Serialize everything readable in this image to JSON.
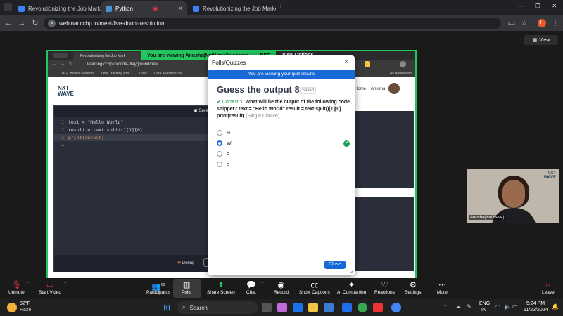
{
  "browser": {
    "tabs": [
      {
        "title": "Revolutionizing the Job Marke",
        "active": false
      },
      {
        "title": "Python",
        "active": true
      },
      {
        "title": "Revolutionizing the Job Marke",
        "active": false
      }
    ],
    "url": "webinar.ccbp.in/meet/live-doubt-resolution",
    "profile_initial": "H"
  },
  "meeting": {
    "view_label": "View",
    "share_banner": "You are viewing  Anusha(NxtWave)'s screen",
    "rec_label": "REC",
    "view_options": "View Options",
    "inner_tab": "Revolutionizing the Job Mark",
    "inner_url": "learning.ccbp.in/code-playground/new",
    "bookmarks": [
      "RGL Bonus Session",
      "Time Tracking Ass...",
      "Calls",
      "Data Analytics Se...",
      "All Bookmarks"
    ],
    "inner_nav": [
      "Home",
      "Anusha"
    ],
    "logo_top": "NXT",
    "logo_bottom": "WAVE",
    "save_label": "Save",
    "debug_label": "Debug",
    "code": [
      {
        "n": "1",
        "text": "text = \"Hello World\""
      },
      {
        "n": "2",
        "text": "result = text.split()[1][0]"
      },
      {
        "n": "3",
        "text": "print(result)"
      },
      {
        "n": "4",
        "text": ""
      }
    ]
  },
  "modal": {
    "header": "Polls/Quizzes",
    "close_icon": "×",
    "banner": "You are viewing your quiz results",
    "title": "Guess the output 8",
    "saved": "Saved",
    "status": "Correct",
    "question": "1. What will be the output of the following code snippet? text = \"Hello World\" result = text.split()[1][0] print(result)",
    "question_type": "(Single Choice)",
    "options": [
      {
        "label": "H",
        "selected": false,
        "correct": false
      },
      {
        "label": "W",
        "selected": true,
        "correct": true
      },
      {
        "label": "o",
        "selected": false,
        "correct": false
      },
      {
        "label": "e",
        "selected": false,
        "correct": false
      }
    ],
    "close_button": "Close"
  },
  "video": {
    "name": "Anusha(NxtWave)",
    "logo_top": "NXT",
    "logo_bottom": "WAVE"
  },
  "toolbar": {
    "unmute": "Unmute",
    "start_video": "Start Video",
    "participants": "Participants",
    "participants_count": "69",
    "polls": "Polls",
    "share_screen": "Share Screen",
    "chat": "Chat",
    "record": "Record",
    "captions": "Show Captions",
    "companion": "AI Companion",
    "reactions": "Reactions",
    "settings": "Settings",
    "more": "More",
    "leave": "Leave"
  },
  "taskbar": {
    "temp": "82°F",
    "weather": "Haze",
    "search": "Search",
    "lang_top": "ENG",
    "lang_bottom": "IN",
    "time": "5:24 PM",
    "date": "11/22/2024"
  },
  "colors": {
    "accent_blue": "#1769d8",
    "share_green": "#23c55e",
    "correct_green": "#1e9e55"
  }
}
